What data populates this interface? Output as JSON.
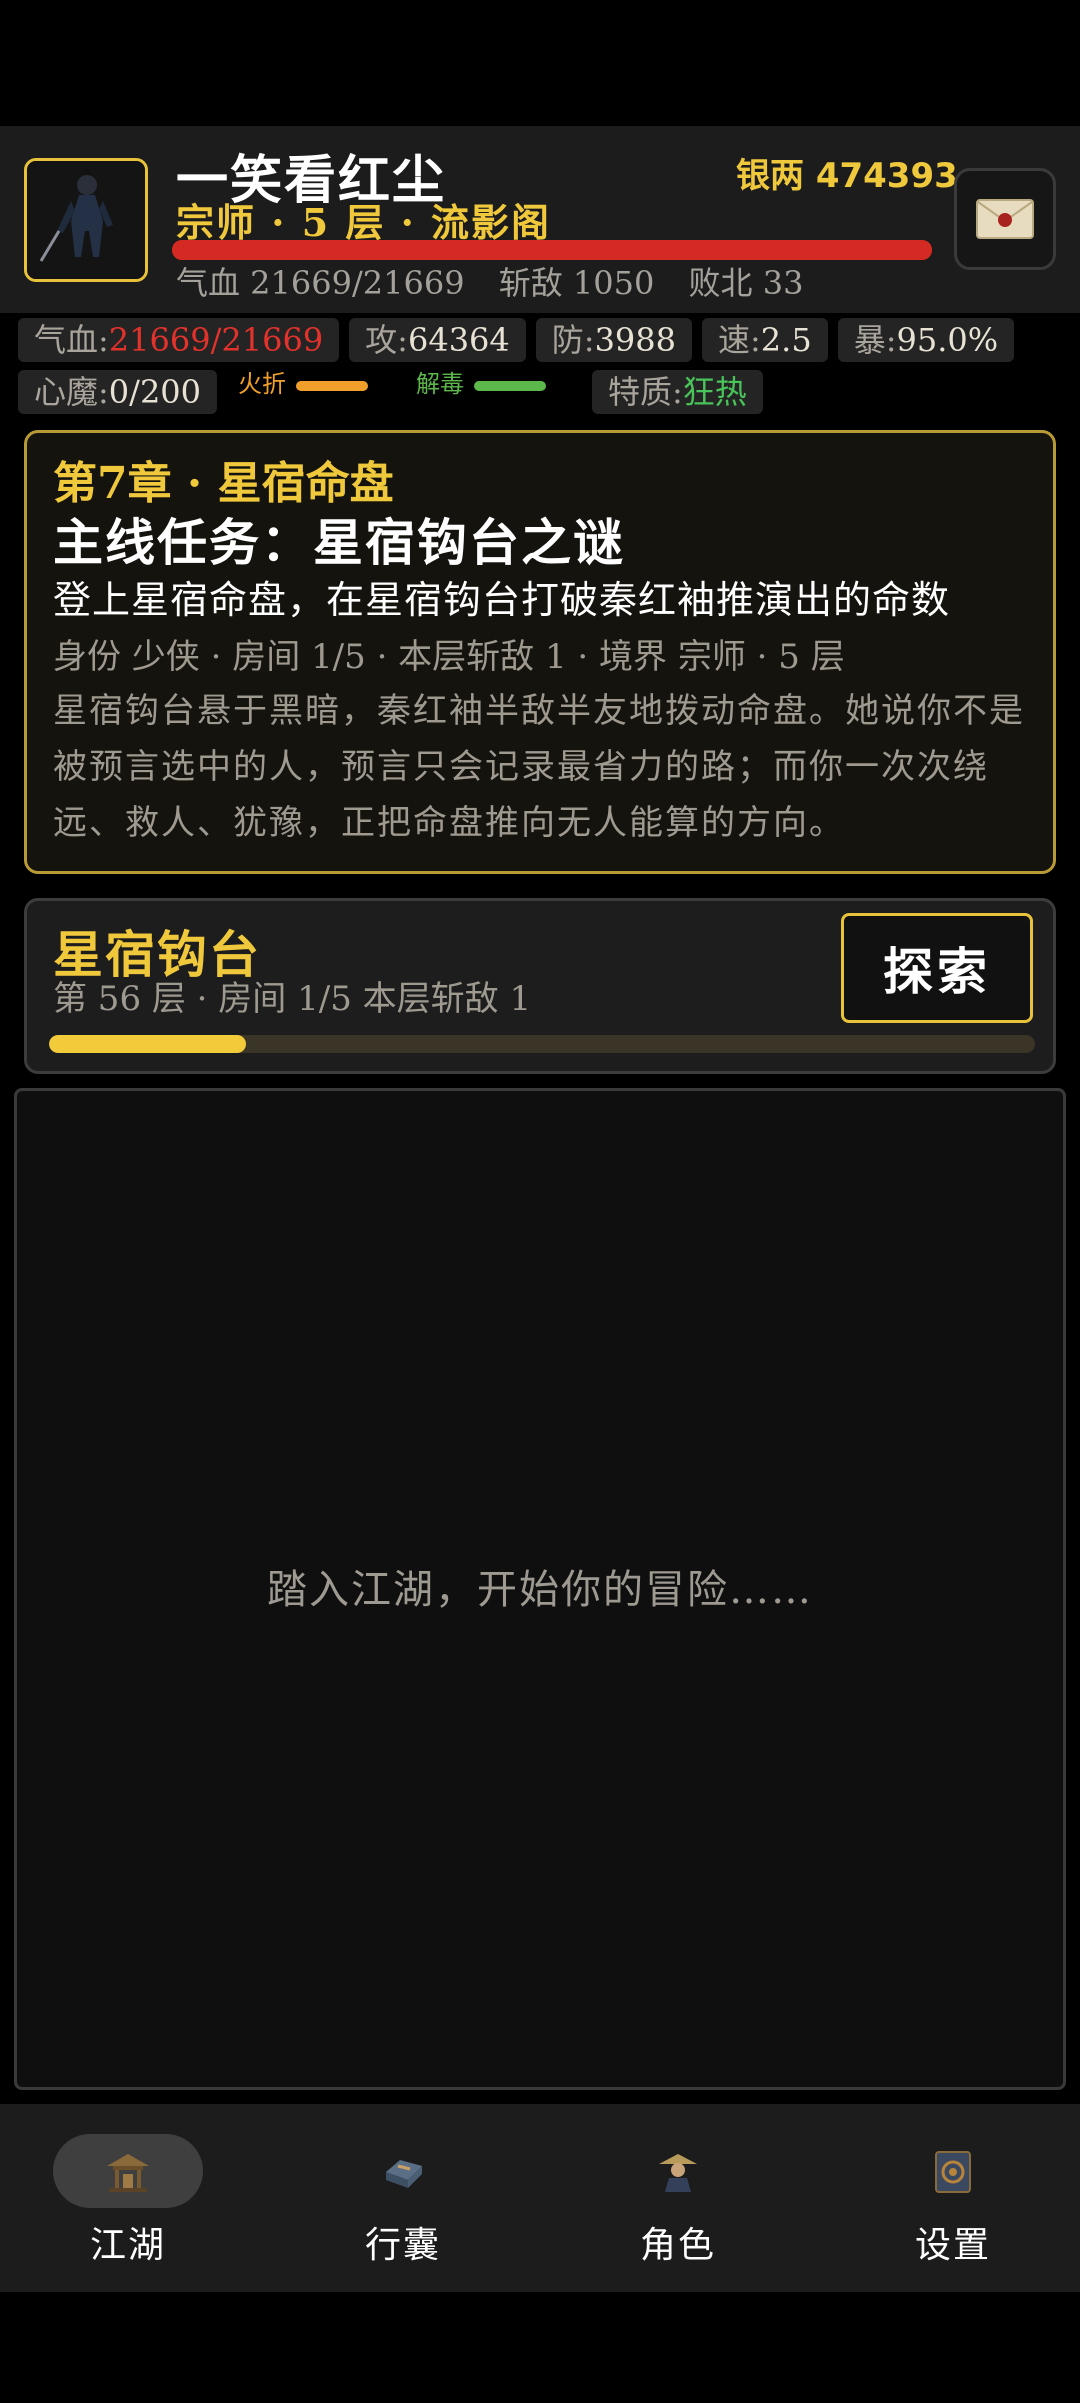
{
  "header": {
    "name": "一笑看红尘",
    "silver": "银两 474393",
    "rank": "宗师 · 5 层 · 流影阁",
    "hp_text": "气血 21669/21669",
    "kills_text": "斩敌 1050",
    "defeats_text": "败北 33",
    "hp_fraction": 1.0
  },
  "stats": {
    "hp_label": "气血:",
    "hp_value": "21669/21669",
    "atk_label": "攻:",
    "atk_value": "64364",
    "def_label": "防:",
    "def_value": "3988",
    "spd_label": "速:",
    "spd_value": "2.5",
    "crit_label": "暴:",
    "crit_value": "95.0%",
    "demon_label": "心魔:",
    "demon_value": "0/200",
    "tag1": "火折",
    "tag2": "解毒",
    "trait_label": "特质:",
    "trait_value": "狂热"
  },
  "quest": {
    "chapter": "第7章 · 星宿命盘",
    "title": "主线任务：星宿钩台之谜",
    "goal": "登上星宿命盘，在星宿钩台打破秦红袖推演出的命数",
    "meta": "身份 少侠 · 房间 1/5 · 本层斩敌 1 · 境界 宗师 · 5 层",
    "description": "星宿钩台悬于黑暗，秦红袖半敌半友地拨动命盘。她说你不是被预言选中的人，预言只会记录最省力的路；而你一次次绕远、救人、犹豫，正把命盘推向无人能算的方向。"
  },
  "location": {
    "name": "星宿钩台",
    "sub": "第 56 层 · 房间 1/5   本层斩敌 1",
    "explore_label": "探索",
    "progress_fraction": 0.2
  },
  "log": {
    "placeholder": "踏入江湖，开始你的冒险……"
  },
  "nav": [
    {
      "label": "江湖",
      "icon": "pavilion-icon",
      "active": true
    },
    {
      "label": "行囊",
      "icon": "bag-icon",
      "active": false
    },
    {
      "label": "角色",
      "icon": "character-icon",
      "active": false
    },
    {
      "label": "设置",
      "icon": "settings-book-icon",
      "active": false
    }
  ],
  "colors": {
    "gold": "#f0c83c",
    "hp_red": "#e3322c",
    "trait_green": "#49c35a",
    "tag_orange": "#f0a02a",
    "tag_green": "#5cb84a"
  }
}
